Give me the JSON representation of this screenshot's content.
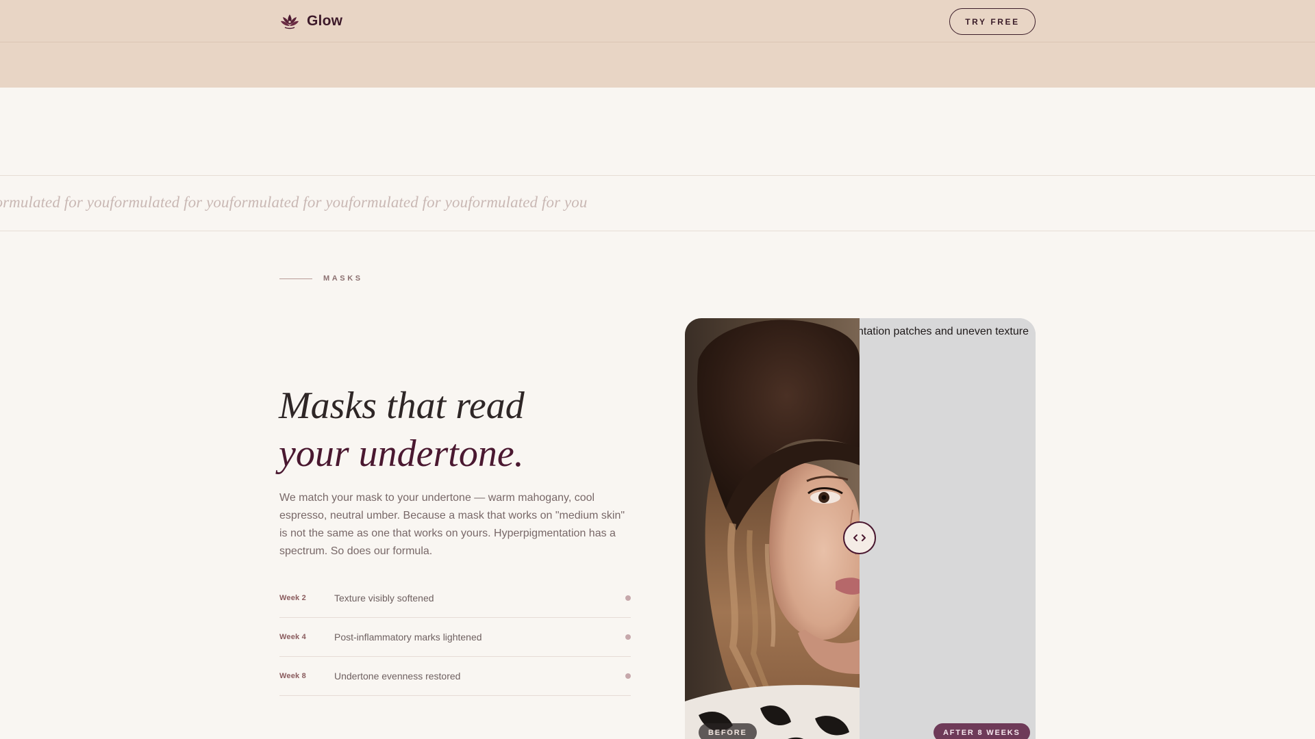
{
  "header": {
    "brand_name": "Glow",
    "brand_icon": "lotus-icon",
    "cta_label": "TRY FREE"
  },
  "marquee": {
    "items": [
      "formulated for you",
      "formulated for you",
      "formulated for you",
      "formulated for you",
      "formulated for you",
      "formulated for you"
    ]
  },
  "section": {
    "label": "MASKS",
    "headline_line1": "Masks that read",
    "headline_line2": "your undertone.",
    "body": "We match your mask to your undertone — warm mahogany, cool espresso, neutral umber. Because a mask that works on \"medium skin\" is not the same as one that works on yours. Hyperpigmentation has a spectrum. So does our formula."
  },
  "timeline": [
    {
      "week": "Week 2",
      "desc": "Texture visibly softened"
    },
    {
      "week": "Week 4",
      "desc": "Post-inflammatory marks lightened"
    },
    {
      "week": "Week 8",
      "desc": "Undertone evenness restored"
    }
  ],
  "compare": {
    "after_alt_text": "ntation patches and uneven texture",
    "before_label": "BEFORE",
    "after_label": "AFTER 8 WEEKS",
    "handle_icon": "compare-arrows-icon",
    "split_fraction": 0.5
  },
  "colors": {
    "header_bg": "#e8d5c5",
    "page_bg": "#f9f6f2",
    "accent": "#4a1830",
    "badge_after": "#6e3a58"
  }
}
